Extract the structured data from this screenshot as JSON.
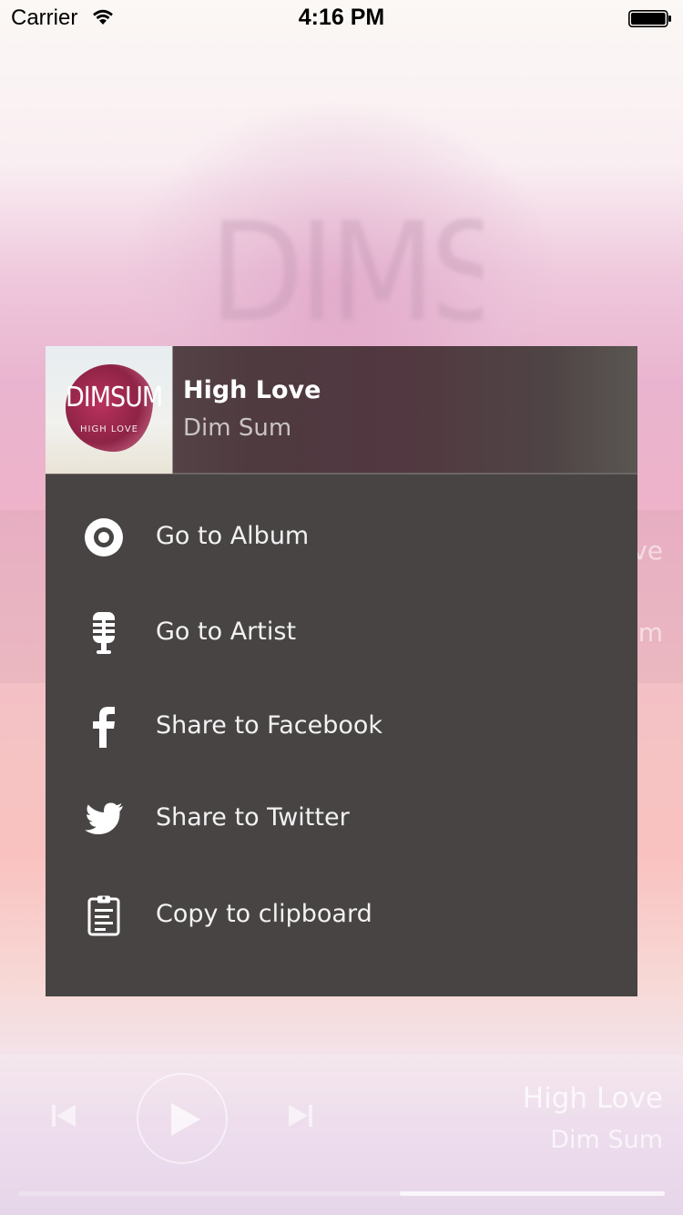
{
  "status_bar": {
    "carrier": "Carrier",
    "time": "4:16 PM",
    "wifi_icon": "wifi-icon",
    "battery_icon": "battery-icon"
  },
  "background": {
    "artwork_text": "DIMSUM",
    "row1_text": "ve",
    "row2_text": "um"
  },
  "menu": {
    "header": {
      "song_title": "High Love",
      "artist": "Dim Sum",
      "album_art_title": "DIMSUM",
      "album_art_subtitle": "HIGH LOVE"
    },
    "items": [
      {
        "label": "Go to Album",
        "icon": "album-icon"
      },
      {
        "label": "Go to Artist",
        "icon": "microphone-icon"
      },
      {
        "label": "Share to Facebook",
        "icon": "facebook-icon"
      },
      {
        "label": "Share to Twitter",
        "icon": "twitter-icon"
      },
      {
        "label": "Copy to clipboard",
        "icon": "clipboard-icon"
      }
    ]
  },
  "player": {
    "now_playing_title": "High Love",
    "now_playing_artist": "Dim Sum",
    "progress": 0.41,
    "controls": [
      "previous-icon",
      "play-icon",
      "next-icon"
    ]
  }
}
